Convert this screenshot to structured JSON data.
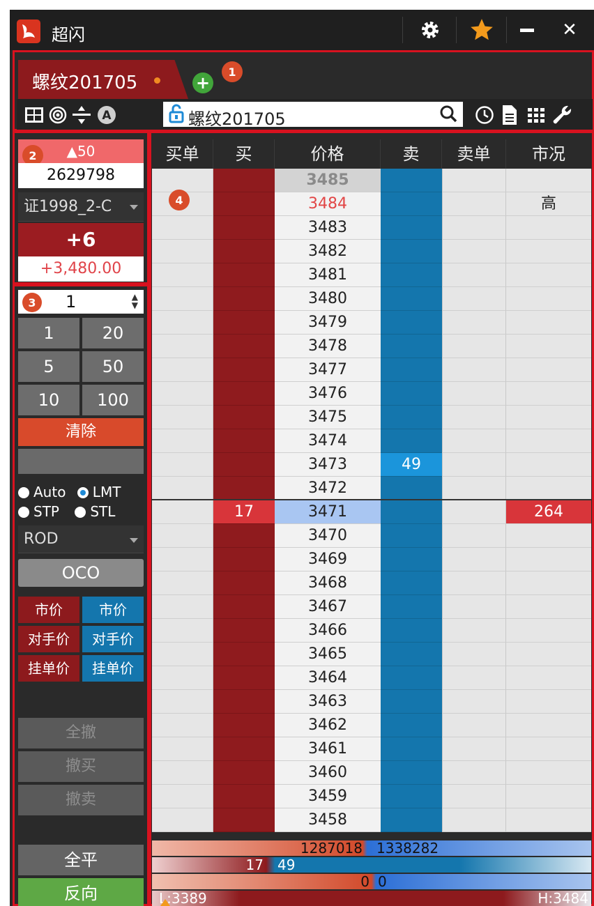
{
  "app": {
    "title": "超闪"
  },
  "titlebar": {
    "settings_icon": "gear-icon",
    "favorite_icon": "star-icon",
    "minimize_icon": "minimize-icon",
    "close_icon": "close-icon",
    "accent": "#f39a1c"
  },
  "tabs": [
    {
      "label": "螺纹201705"
    }
  ],
  "markers": [
    "1",
    "2",
    "3",
    "4"
  ],
  "toolbar": {
    "symbol": "螺纹201705"
  },
  "position": {
    "change": "▲50",
    "volume": "2629798",
    "account": "证1998_2-C",
    "net": "+6",
    "pnl": "+3,480.00"
  },
  "order": {
    "quantity": "1",
    "quick_qty": [
      "1",
      "20",
      "5",
      "50",
      "10",
      "100"
    ],
    "clear_label": "清除",
    "price_types": [
      {
        "label": "Auto",
        "selected": false
      },
      {
        "label": "LMT",
        "selected": true
      },
      {
        "label": "STP",
        "selected": false
      },
      {
        "label": "STL",
        "selected": false
      }
    ],
    "tif": "ROD",
    "oco_label": "OCO",
    "buy_market": "市价",
    "sell_market": "市价",
    "buy_opponent": "对手价",
    "sell_opponent": "对手价",
    "buy_queue": "挂单价",
    "sell_queue": "挂单价",
    "cancel_all": "全撤",
    "cancel_buy": "撤买",
    "cancel_sell": "撤卖",
    "flatten": "全平",
    "reverse": "反向"
  },
  "ladder": {
    "headers": [
      "买单",
      "买",
      "价格",
      "卖",
      "卖单",
      "市况"
    ],
    "rows": [
      {
        "price": "3485",
        "bid": "",
        "ask": "",
        "market": "",
        "style": "top"
      },
      {
        "price": "3484",
        "bid": "",
        "ask": "",
        "market": "高",
        "style": "high"
      },
      {
        "price": "3483",
        "bid": "",
        "ask": "",
        "market": ""
      },
      {
        "price": "3482",
        "bid": "",
        "ask": "",
        "market": ""
      },
      {
        "price": "3481",
        "bid": "",
        "ask": "",
        "market": ""
      },
      {
        "price": "3480",
        "bid": "",
        "ask": "",
        "market": ""
      },
      {
        "price": "3479",
        "bid": "",
        "ask": "",
        "market": ""
      },
      {
        "price": "3478",
        "bid": "",
        "ask": "",
        "market": ""
      },
      {
        "price": "3477",
        "bid": "",
        "ask": "",
        "market": ""
      },
      {
        "price": "3476",
        "bid": "",
        "ask": "",
        "market": ""
      },
      {
        "price": "3475",
        "bid": "",
        "ask": "",
        "market": ""
      },
      {
        "price": "3474",
        "bid": "",
        "ask": "",
        "market": ""
      },
      {
        "price": "3473",
        "bid": "",
        "ask": "49",
        "market": "",
        "style": "ask"
      },
      {
        "price": "3472",
        "bid": "",
        "ask": "",
        "market": ""
      },
      {
        "price": "3471",
        "bid": "17",
        "ask": "",
        "market": "264",
        "style": "last"
      },
      {
        "price": "3470",
        "bid": "",
        "ask": "",
        "market": ""
      },
      {
        "price": "3469",
        "bid": "",
        "ask": "",
        "market": ""
      },
      {
        "price": "3468",
        "bid": "",
        "ask": "",
        "market": ""
      },
      {
        "price": "3467",
        "bid": "",
        "ask": "",
        "market": ""
      },
      {
        "price": "3466",
        "bid": "",
        "ask": "",
        "market": ""
      },
      {
        "price": "3465",
        "bid": "",
        "ask": "",
        "market": ""
      },
      {
        "price": "3464",
        "bid": "",
        "ask": "",
        "market": ""
      },
      {
        "price": "3463",
        "bid": "",
        "ask": "",
        "market": ""
      },
      {
        "price": "3462",
        "bid": "",
        "ask": "",
        "market": ""
      },
      {
        "price": "3461",
        "bid": "",
        "ask": "",
        "market": ""
      },
      {
        "price": "3460",
        "bid": "",
        "ask": "",
        "market": ""
      },
      {
        "price": "3459",
        "bid": "",
        "ask": "",
        "market": ""
      },
      {
        "price": "3458",
        "bid": "",
        "ask": "",
        "market": ""
      }
    ]
  },
  "summary": {
    "total_bid": "1287018",
    "total_ask": "1338282",
    "best_bid": "17",
    "best_ask": "49",
    "bid_orders": "0",
    "ask_orders": "0",
    "low_label": "L:3389",
    "high_label": "H:3484",
    "colors": {
      "bid": "#c83a23",
      "ask": "#2c6fd6"
    }
  }
}
